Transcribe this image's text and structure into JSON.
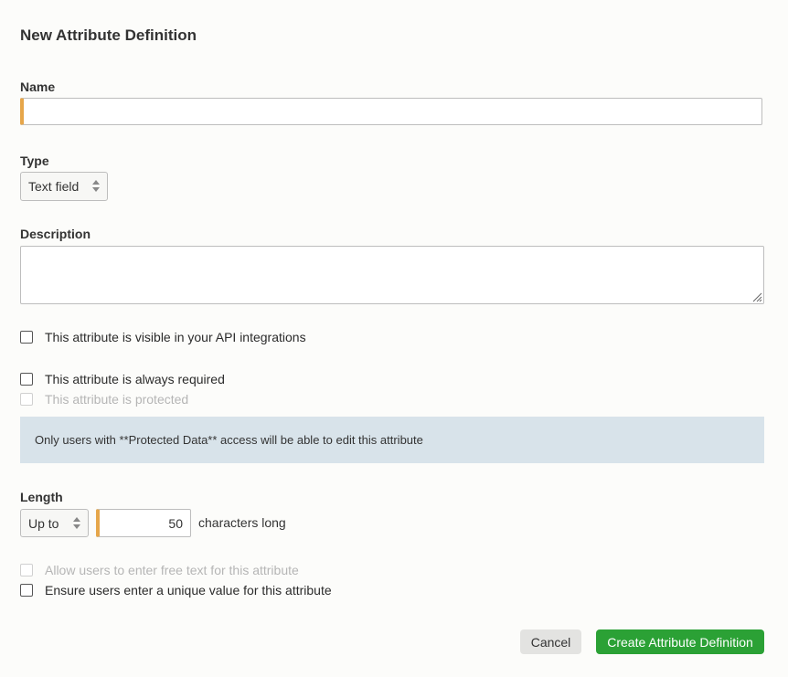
{
  "dialog": {
    "title": "New Attribute Definition"
  },
  "name_field": {
    "label": "Name",
    "value": "",
    "placeholder": ""
  },
  "type_field": {
    "label": "Type",
    "selected": "Text field"
  },
  "description_field": {
    "label": "Description",
    "value": ""
  },
  "checkboxes": {
    "api_visible": {
      "label": "This attribute is visible in your API integrations",
      "checked": false
    },
    "always_required": {
      "label": "This attribute is always required",
      "checked": false
    },
    "protected": {
      "label": "This attribute is protected",
      "checked": false,
      "disabled": true
    }
  },
  "info_banner": {
    "text": "Only users with **Protected Data** access will be able to edit this attribute"
  },
  "length_field": {
    "label": "Length",
    "mode_selected": "Up to",
    "value": "50",
    "suffix": "characters long"
  },
  "options": {
    "free_text": {
      "label": "Allow users to enter free text for this attribute",
      "checked": false,
      "disabled": true
    },
    "unique_value": {
      "label": "Ensure users enter a unique value for this attribute",
      "checked": false
    }
  },
  "buttons": {
    "cancel": "Cancel",
    "create": "Create Attribute Definition"
  },
  "colors": {
    "accent_required": "#e6a64a",
    "primary_button": "#2ba135",
    "info_background": "#d8e3ea"
  }
}
